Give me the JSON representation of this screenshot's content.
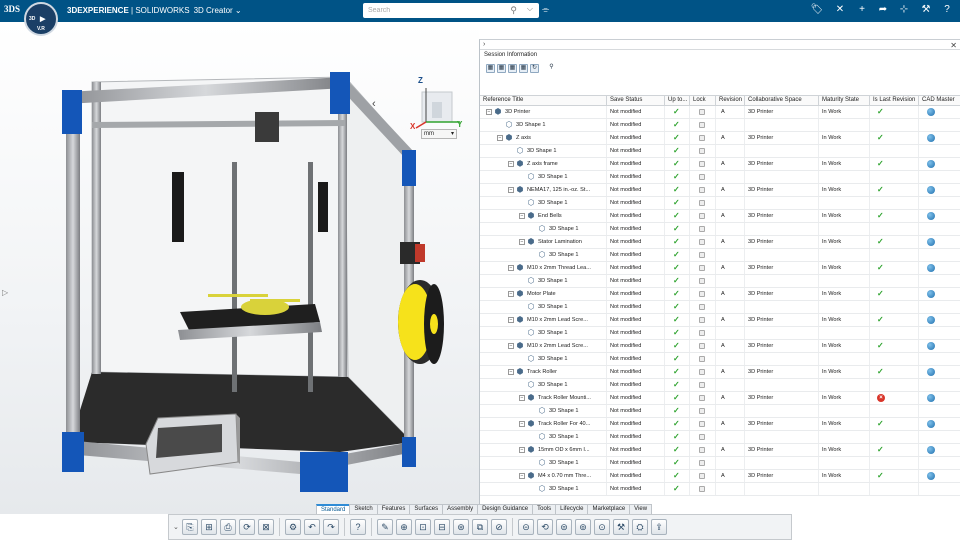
{
  "app": {
    "logo": "3DS",
    "brand_bold": "3DEXPERIENCE",
    "brand_rest": " | SOLIDWORKS",
    "app_name": "3D Creator",
    "app_caret": "⌄",
    "compass_n": "3D",
    "compass_s": "V.R",
    "compass_w": "",
    "compass_e": ""
  },
  "search": {
    "placeholder": "Search",
    "search_icon": "⚲",
    "tag_icon": "⌵"
  },
  "toolbar_icons": [
    "tag-icon",
    "close-icon",
    "add-icon",
    "share-arrow-icon",
    "network-icon",
    "tools-icon",
    "help-icon",
    "user-icon"
  ],
  "toolbar_glyphs": [
    "🏷",
    "✕",
    "+",
    "➦",
    "⊹",
    "⚒",
    "?",
    "☺"
  ],
  "viewport": {
    "view_x": "X",
    "view_y": "Y",
    "view_z": "Z",
    "unit": "mm",
    "collapse_glyph": "‹",
    "side_arrow": "▷"
  },
  "panel": {
    "expand_glyph": "›",
    "close_glyph": "✕",
    "title": "Session Information",
    "tool_glyphs": [
      "▦",
      "▦",
      "▦",
      "▦",
      "↻",
      "⚲"
    ]
  },
  "columns": [
    "Reference Title",
    "Save Status",
    "Up to...",
    "Lock",
    "Revision",
    "Collaborative Space",
    "Maturity State",
    "Is Last Revision",
    "CAD Master"
  ],
  "rows": [
    {
      "title": "3D Printer",
      "level": 0,
      "exp": "−",
      "status": "Not modified",
      "up": true,
      "lock": true,
      "rev": "A",
      "space": "3D Printer",
      "maturity": "In Work",
      "last": "ok",
      "master": true
    },
    {
      "title": "3D Shape 1",
      "level": 1,
      "exp": "",
      "status": "Not modified",
      "up": true,
      "lock": true,
      "rev": "",
      "space": "",
      "maturity": "",
      "last": "",
      "master": false
    },
    {
      "title": "Z axis",
      "level": 1,
      "exp": "−",
      "status": "Not modified",
      "up": true,
      "lock": true,
      "rev": "A",
      "space": "3D Printer",
      "maturity": "In Work",
      "last": "ok",
      "master": true
    },
    {
      "title": "3D Shape 1",
      "level": 2,
      "exp": "",
      "status": "Not modified",
      "up": true,
      "lock": true,
      "rev": "",
      "space": "",
      "maturity": "",
      "last": "",
      "master": false
    },
    {
      "title": "Z axis frame",
      "level": 2,
      "exp": "−",
      "status": "Not modified",
      "up": true,
      "lock": true,
      "rev": "A",
      "space": "3D Printer",
      "maturity": "In Work",
      "last": "ok",
      "master": true
    },
    {
      "title": "3D Shape 1",
      "level": 3,
      "exp": "",
      "status": "Not modified",
      "up": true,
      "lock": true,
      "rev": "",
      "space": "",
      "maturity": "",
      "last": "",
      "master": false
    },
    {
      "title": "NEMA17, 125 in.-oz. St...",
      "level": 2,
      "exp": "−",
      "status": "Not modified",
      "up": true,
      "lock": true,
      "rev": "A",
      "space": "3D Printer",
      "maturity": "In Work",
      "last": "ok",
      "master": true
    },
    {
      "title": "3D Shape 1",
      "level": 3,
      "exp": "",
      "status": "Not modified",
      "up": true,
      "lock": true,
      "rev": "",
      "space": "",
      "maturity": "",
      "last": "",
      "master": false
    },
    {
      "title": "End Bells",
      "level": 3,
      "exp": "−",
      "status": "Not modified",
      "up": true,
      "lock": true,
      "rev": "A",
      "space": "3D Printer",
      "maturity": "In Work",
      "last": "ok",
      "master": true
    },
    {
      "title": "3D Shape 1",
      "level": 4,
      "exp": "",
      "status": "Not modified",
      "up": true,
      "lock": true,
      "rev": "",
      "space": "",
      "maturity": "",
      "last": "",
      "master": false
    },
    {
      "title": "Stator Lamination",
      "level": 3,
      "exp": "−",
      "status": "Not modified",
      "up": true,
      "lock": true,
      "rev": "A",
      "space": "3D Printer",
      "maturity": "In Work",
      "last": "ok",
      "master": true
    },
    {
      "title": "3D Shape 1",
      "level": 4,
      "exp": "",
      "status": "Not modified",
      "up": true,
      "lock": true,
      "rev": "",
      "space": "",
      "maturity": "",
      "last": "",
      "master": false
    },
    {
      "title": "M10 x 2mm Thread Lea...",
      "level": 2,
      "exp": "−",
      "status": "Not modified",
      "up": true,
      "lock": true,
      "rev": "A",
      "space": "3D Printer",
      "maturity": "In Work",
      "last": "ok",
      "master": true
    },
    {
      "title": "3D Shape 1",
      "level": 3,
      "exp": "",
      "status": "Not modified",
      "up": true,
      "lock": true,
      "rev": "",
      "space": "",
      "maturity": "",
      "last": "",
      "master": false
    },
    {
      "title": "Motor Plate",
      "level": 2,
      "exp": "−",
      "status": "Not modified",
      "up": true,
      "lock": true,
      "rev": "A",
      "space": "3D Printer",
      "maturity": "In Work",
      "last": "ok",
      "master": true
    },
    {
      "title": "3D Shape 1",
      "level": 3,
      "exp": "",
      "status": "Not modified",
      "up": true,
      "lock": true,
      "rev": "",
      "space": "",
      "maturity": "",
      "last": "",
      "master": false
    },
    {
      "title": "M10 x 2mm Lead Scre...",
      "level": 2,
      "exp": "−",
      "status": "Not modified",
      "up": true,
      "lock": true,
      "rev": "A",
      "space": "3D Printer",
      "maturity": "In Work",
      "last": "ok",
      "master": true
    },
    {
      "title": "3D Shape 1",
      "level": 3,
      "exp": "",
      "status": "Not modified",
      "up": true,
      "lock": true,
      "rev": "",
      "space": "",
      "maturity": "",
      "last": "",
      "master": false
    },
    {
      "title": "M10 x 2mm Lead Scre...",
      "level": 2,
      "exp": "−",
      "status": "Not modified",
      "up": true,
      "lock": true,
      "rev": "A",
      "space": "3D Printer",
      "maturity": "In Work",
      "last": "ok",
      "master": true
    },
    {
      "title": "3D Shape 1",
      "level": 3,
      "exp": "",
      "status": "Not modified",
      "up": true,
      "lock": true,
      "rev": "",
      "space": "",
      "maturity": "",
      "last": "",
      "master": false
    },
    {
      "title": "Track Roller",
      "level": 2,
      "exp": "−",
      "status": "Not modified",
      "up": true,
      "lock": true,
      "rev": "A",
      "space": "3D Printer",
      "maturity": "In Work",
      "last": "ok",
      "master": true
    },
    {
      "title": "3D Shape 1",
      "level": 3,
      "exp": "",
      "status": "Not modified",
      "up": true,
      "lock": true,
      "rev": "",
      "space": "",
      "maturity": "",
      "last": "",
      "master": false
    },
    {
      "title": "Track Roller Mounti...",
      "level": 3,
      "exp": "−",
      "status": "Not modified",
      "up": true,
      "lock": true,
      "rev": "A",
      "space": "3D Printer",
      "maturity": "In Work",
      "last": "err",
      "master": true
    },
    {
      "title": "3D Shape 1",
      "level": 4,
      "exp": "",
      "status": "Not modified",
      "up": true,
      "lock": true,
      "rev": "",
      "space": "",
      "maturity": "",
      "last": "",
      "master": false
    },
    {
      "title": "Track Roller For 40...",
      "level": 3,
      "exp": "−",
      "status": "Not modified",
      "up": true,
      "lock": true,
      "rev": "A",
      "space": "3D Printer",
      "maturity": "In Work",
      "last": "ok",
      "master": true
    },
    {
      "title": "3D Shape 1",
      "level": 4,
      "exp": "",
      "status": "Not modified",
      "up": true,
      "lock": true,
      "rev": "",
      "space": "",
      "maturity": "",
      "last": "",
      "master": false
    },
    {
      "title": "15mm OD x 6mm I...",
      "level": 3,
      "exp": "−",
      "status": "Not modified",
      "up": true,
      "lock": true,
      "rev": "A",
      "space": "3D Printer",
      "maturity": "In Work",
      "last": "ok",
      "master": true
    },
    {
      "title": "3D Shape 1",
      "level": 4,
      "exp": "",
      "status": "Not modified",
      "up": true,
      "lock": true,
      "rev": "",
      "space": "",
      "maturity": "",
      "last": "",
      "master": false
    },
    {
      "title": "M4 x 0.70 mm Thre...",
      "level": 3,
      "exp": "−",
      "status": "Not modified",
      "up": true,
      "lock": true,
      "rev": "A",
      "space": "3D Printer",
      "maturity": "In Work",
      "last": "ok",
      "master": true
    },
    {
      "title": "3D Shape 1",
      "level": 4,
      "exp": "",
      "status": "Not modified",
      "up": true,
      "lock": true,
      "rev": "",
      "space": "",
      "maturity": "",
      "last": "",
      "master": false
    }
  ],
  "tabs": [
    "Standard",
    "Sketch",
    "Features",
    "Surfaces",
    "Assembly",
    "Design Guidance",
    "Tools",
    "Lifecycle",
    "Marketplace",
    "View"
  ],
  "active_tab": "Standard",
  "action_icons": [
    "open-icon",
    "save-icon",
    "save-all-icon",
    "refresh-icon",
    "print-icon",
    "settings-icon",
    "undo-icon",
    "redo-icon",
    "help-icon",
    "measure-icon",
    "component-icon",
    "insert-icon",
    "mate-icon",
    "pattern-icon",
    "mirror-icon",
    "explode-icon",
    "display-icon",
    "rotate-icon",
    "section-icon",
    "view-icon",
    "render-icon",
    "tools-icon",
    "configure-icon",
    "export-icon"
  ],
  "action_glyphs": [
    "⎘",
    "⊞",
    "⎙",
    "⟳",
    "⊠",
    "⚙",
    "↶",
    "↷",
    "?",
    "✎",
    "⊕",
    "⊡",
    "⊟",
    "⊛",
    "⧉",
    "⊘",
    "⊝",
    "⟲",
    "⊜",
    "⊚",
    "⊙",
    "⚒",
    "⛭",
    "⇪"
  ],
  "colors": {
    "topbar": "#005386",
    "accent": "#2f8cd6",
    "frame_blue": "#1456b8",
    "filament": "#f6e21b",
    "ok": "#2fa32f",
    "error": "#d9352a"
  }
}
